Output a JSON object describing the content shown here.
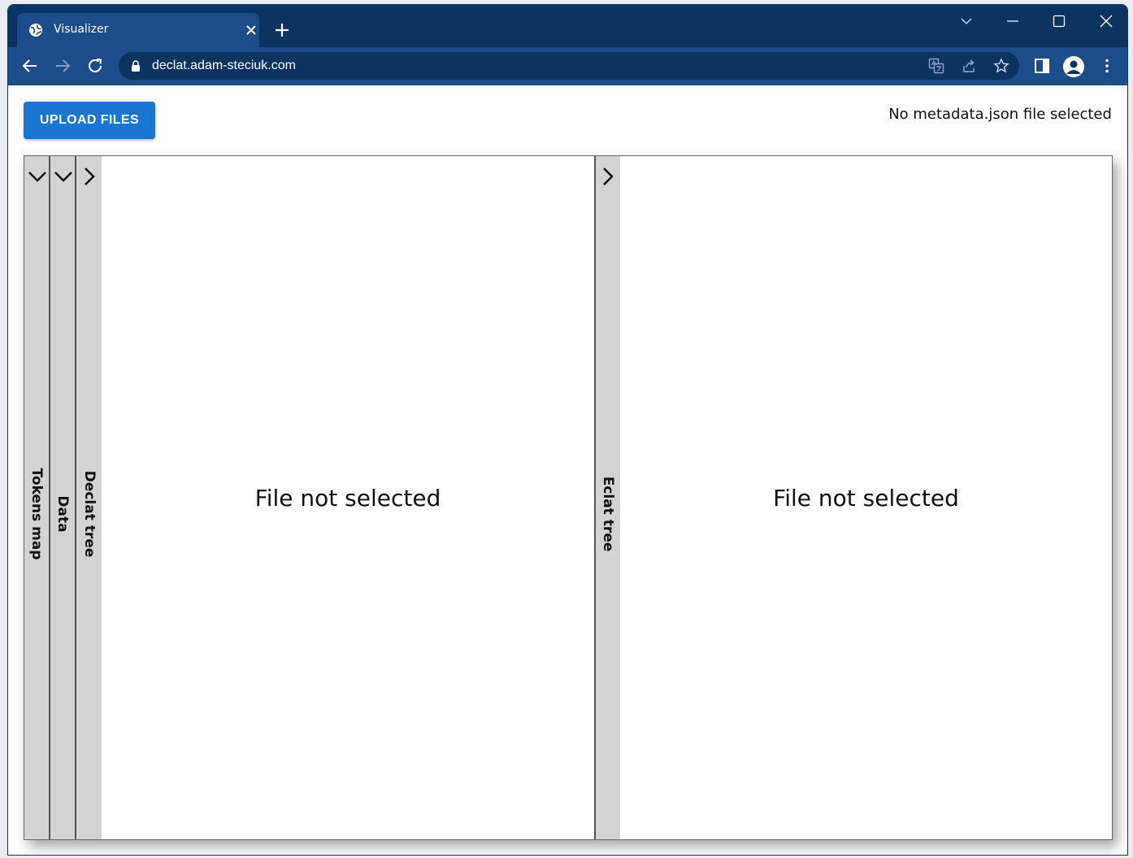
{
  "browser": {
    "tab_title": "Visualizer",
    "url": "declat.adam-steciuk.com",
    "icons": {
      "favicon": "globe-icon",
      "tab_close": "close-icon",
      "new_tab": "plus-icon",
      "tab_search": "chevron-down-icon",
      "minimize": "minimize-icon",
      "maximize": "maximize-icon",
      "close_window": "close-icon",
      "back": "arrow-left-icon",
      "forward": "arrow-right-icon",
      "reload": "reload-icon",
      "lock": "lock-icon",
      "translate": "translate-icon",
      "share": "share-icon",
      "bookmark": "star-icon",
      "side_panel": "side-panel-icon",
      "profile": "avatar-icon",
      "menu": "kebab-menu-icon"
    },
    "colors": {
      "titlebar": "#0c3461",
      "toolbar": "#1b4d8a"
    }
  },
  "page": {
    "upload_button_label": "UPLOAD FILES",
    "metadata_status": "No metadata.json file selected",
    "accent_color": "#1976d2",
    "strips": {
      "tokens_map": {
        "label": "Tokens map",
        "state": "expanded"
      },
      "data": {
        "label": "Data",
        "state": "expanded"
      },
      "declat_tree": {
        "label": "Declat tree",
        "state": "collapsed"
      },
      "eclat_tree": {
        "label": "Eclat tree",
        "state": "collapsed"
      }
    },
    "left_pane_message": "File not selected",
    "right_pane_message": "File not selected"
  }
}
